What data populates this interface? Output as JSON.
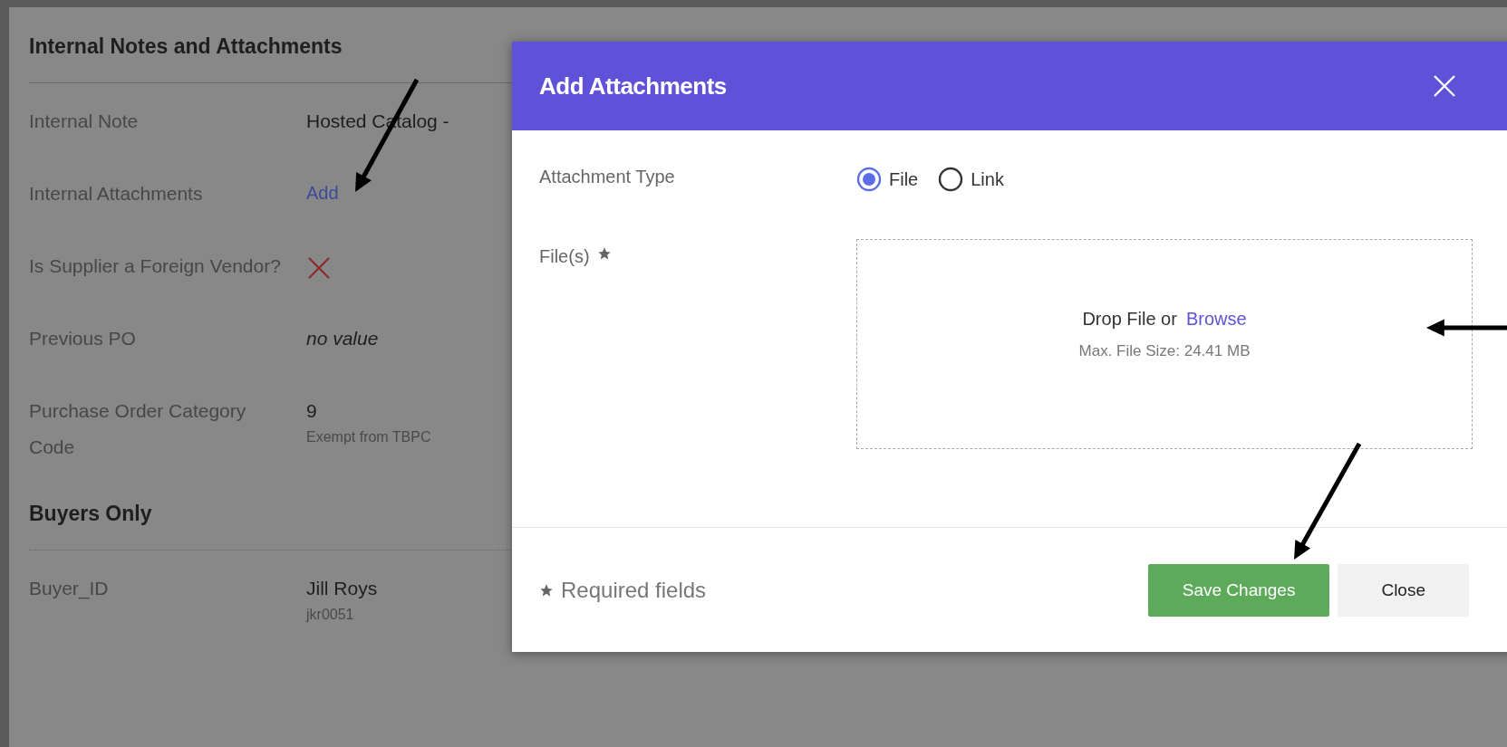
{
  "page": {
    "sections": [
      {
        "title": "Internal Notes and Attachments",
        "dotted_divider": false,
        "rows": [
          {
            "label": "Internal Note",
            "kind": "text",
            "value": "Hosted Catalog -"
          },
          {
            "label": "Internal Attachments",
            "kind": "link",
            "value": "Add"
          },
          {
            "label": "Is Supplier a Foreign Vendor?",
            "kind": "cross"
          },
          {
            "label": "Previous PO",
            "kind": "empty",
            "value": "no value"
          },
          {
            "label": "Purchase Order Category Code",
            "kind": "text",
            "value": "9",
            "sub": "Exempt from TBPC"
          }
        ]
      },
      {
        "title": "Buyers Only",
        "dotted_divider": true,
        "rows": [
          {
            "label": "Buyer_ID",
            "kind": "text",
            "value": "Jill Roys",
            "sub": "jkr0051"
          }
        ]
      }
    ]
  },
  "dialog": {
    "title": "Add Attachments",
    "attachment_type": {
      "label": "Attachment Type",
      "options": [
        {
          "label": "File",
          "selected": true
        },
        {
          "label": "Link",
          "selected": false
        }
      ]
    },
    "files": {
      "label": "File(s)",
      "drop_text": "Drop File or",
      "browse": "Browse",
      "max_size": "Max. File Size: 24.41 MB"
    },
    "required_note": "Required fields",
    "buttons": [
      {
        "label": "Save Changes",
        "kind": "primary"
      },
      {
        "label": "Close",
        "kind": "secondary"
      }
    ]
  }
}
